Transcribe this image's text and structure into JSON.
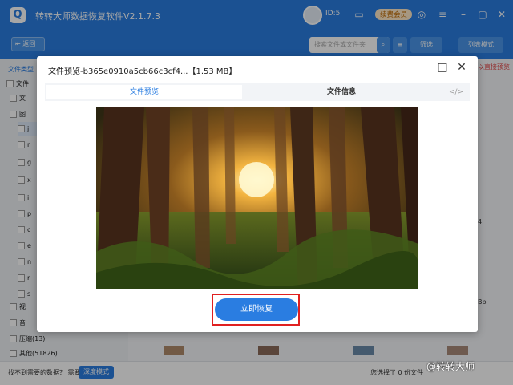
{
  "app": {
    "title": "转转大师数据恢复软件V2.1.7.3",
    "logo": "Q",
    "user_id": "ID:5",
    "vip_label": "续费会员"
  },
  "toolbar": {
    "back_label": "返回",
    "search_placeholder": "搜索文件或文件夹",
    "filter_label": "筛选",
    "view_mode_label": "列表模式"
  },
  "sidebar": {
    "header": "文件类型",
    "items": [
      {
        "label": "文件",
        "kind": "folder"
      },
      {
        "label": "文",
        "kind": "folder"
      },
      {
        "label": "图",
        "kind": "folder"
      },
      {
        "label": "j",
        "kind": "file"
      },
      {
        "label": "r",
        "kind": "file"
      },
      {
        "label": "g",
        "kind": "file"
      },
      {
        "label": "x",
        "kind": "file"
      },
      {
        "label": "i",
        "kind": "file"
      },
      {
        "label": "p",
        "kind": "file"
      },
      {
        "label": "c",
        "kind": "file"
      },
      {
        "label": "e",
        "kind": "file"
      },
      {
        "label": "n",
        "kind": "file"
      },
      {
        "label": "r",
        "kind": "file"
      },
      {
        "label": "s",
        "kind": "file"
      },
      {
        "label": "视",
        "kind": "folder"
      },
      {
        "label": "音",
        "kind": "folder"
      },
      {
        "label": "压缩(13)",
        "kind": "folder"
      },
      {
        "label": "其他(51826)",
        "kind": "folder"
      }
    ]
  },
  "main": {
    "right_hint": "可以直接预览",
    "side_labels": [
      "4",
      "Bb"
    ]
  },
  "bottombar": {
    "prompt": "找不到需要的数据？ 需要",
    "deep_mode_label": "深度模式",
    "selected_text": "您选择了 0 份文件"
  },
  "modal": {
    "title": "文件预览-b365e0910a5cb66c3cf4...【1.53 MB】",
    "tab_preview": "文件预览",
    "tab_info": "文件信息",
    "code_icon_text": "</>",
    "recover_label": "立即恢复"
  },
  "watermark": "@转转大师",
  "colors": {
    "brand": "#2a7de1",
    "highlight": "#e02020"
  }
}
